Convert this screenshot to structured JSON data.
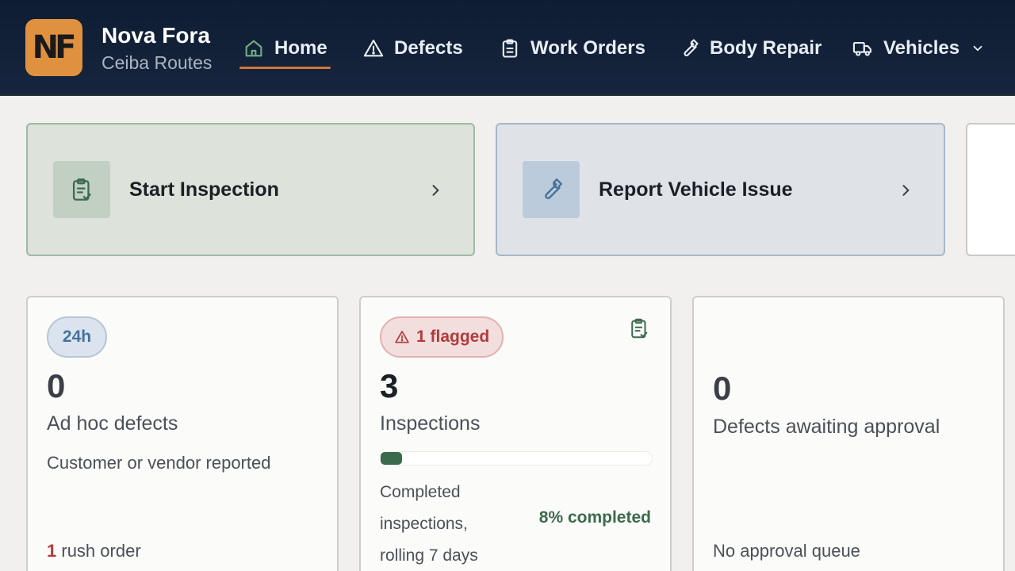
{
  "brand": {
    "name": "Nova Fora",
    "subtitle": "Ceiba Routes",
    "logo_text": "NF"
  },
  "nav": {
    "home": "Home",
    "defects": "Defects",
    "work_orders": "Work Orders",
    "body_repair": "Body Repair",
    "vehicles": "Vehicles"
  },
  "actions": {
    "start_inspection": "Start Inspection",
    "report_issue": "Report Vehicle Issue"
  },
  "cards": {
    "adhoc": {
      "badge": "24h",
      "count": "0",
      "label": "Ad hoc defects",
      "subtitle": "Customer or vendor reported",
      "rush_count": "1",
      "rush_label": "rush order"
    },
    "inspections": {
      "badge": "1 flagged",
      "count": "3",
      "label": "Inspections",
      "progress_fraction": 0.08,
      "description": "Completed inspections, rolling 7 days",
      "percent_text": "8% completed"
    },
    "approval": {
      "count": "0",
      "label": "Defects awaiting approval",
      "footer": "No approval queue"
    }
  },
  "colors": {
    "header_bg": "#0f1d33",
    "accent_orange": "#d2773a",
    "success_green": "#3c6a4d",
    "danger_red": "#b23b3b",
    "info_blue": "#47729c"
  },
  "icons": {
    "home": "home-icon",
    "defects": "warning-triangle-icon",
    "work_orders": "clipboard-icon",
    "body_repair": "wrench-icon",
    "vehicles": "truck-icon",
    "inspection": "clipboard-check-icon",
    "report": "wrench-icon"
  }
}
